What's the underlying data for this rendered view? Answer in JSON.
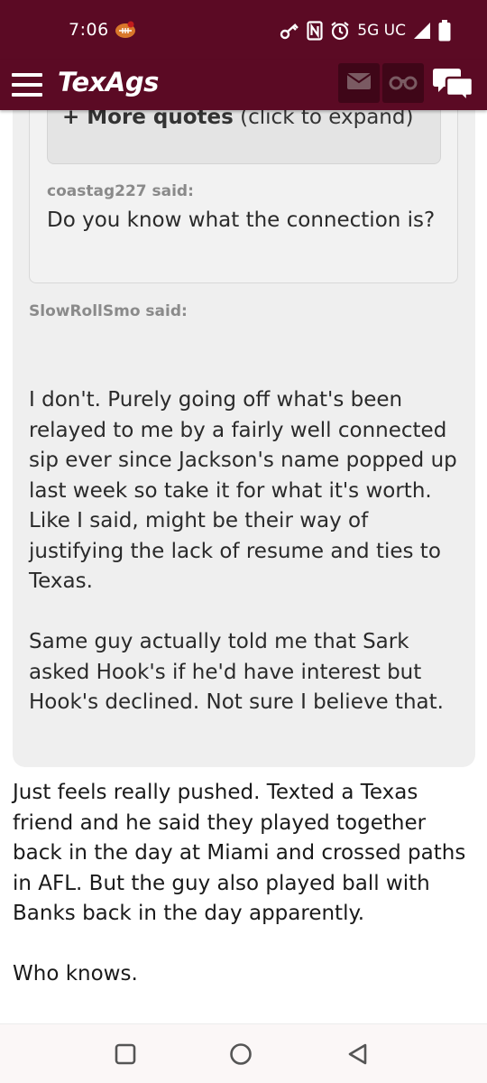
{
  "status_bar": {
    "time": "7:06",
    "network": "5G UC",
    "icons": [
      "app-football-icon",
      "key-icon",
      "nfc-icon",
      "alarm-icon",
      "signal-icon",
      "battery-icon"
    ]
  },
  "app_bar": {
    "logo": "TexAgs",
    "icons": [
      "menu-icon",
      "mail-icon",
      "binoculars-icon",
      "chat-icon"
    ],
    "colors": {
      "brand": "#5b0a24",
      "button": "#3f0618"
    }
  },
  "thread": {
    "more_quotes": {
      "bold": "+ More quotes",
      "rest": " (click to expand)"
    },
    "inner_quote": {
      "author": "coastag227 said:",
      "text": "Do you know what the connection is?"
    },
    "outer_quote": {
      "author": "SlowRollSmo said:",
      "text": "I don't. Purely going off what's been relayed to me by a fairly well connected sip ever since Jackson's name popped up last week so take it for what it's worth. Like I said, might be their way of justifying the lack of resume and ties to Texas.\n\nSame guy actually told me that Sark asked Hook's if he'd have interest but Hook's declined. Not sure I believe that."
    },
    "reply": {
      "text": "Just feels really pushed. Texted a Texas friend and he said they played together back in the day at Miami and crossed paths in AFL. But the guy also played ball with Banks back in the day apparently.\n\nWho knows."
    }
  },
  "nav_bar": {
    "icons": [
      "recents-icon",
      "home-icon",
      "back-icon"
    ]
  }
}
